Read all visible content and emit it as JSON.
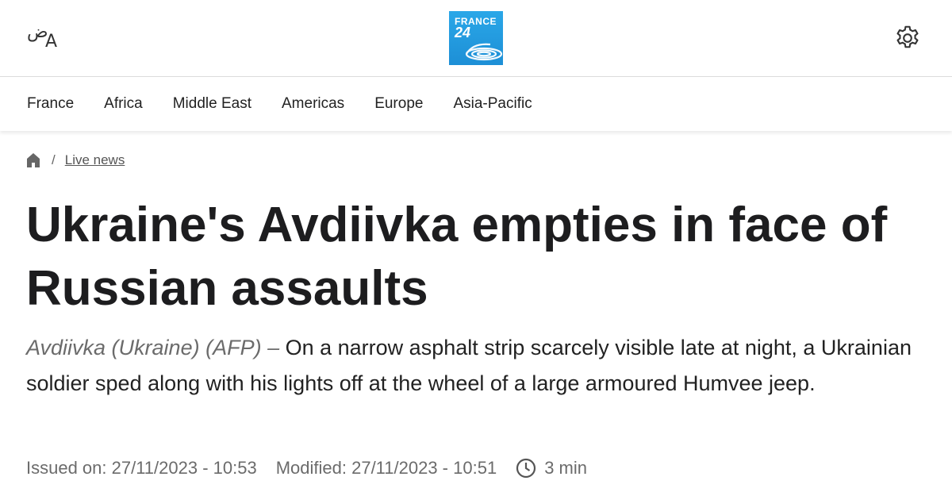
{
  "header": {
    "lang_switch": {
      "arabic_glyph": "ض",
      "latin_glyph": "A",
      "icon": "language-icon"
    },
    "logo": {
      "line1": "FRANCE",
      "line2": "24",
      "brand_color": "#1d8fd6"
    },
    "settings_icon": "gear-icon"
  },
  "nav": {
    "items": [
      {
        "label": "France"
      },
      {
        "label": "Africa"
      },
      {
        "label": "Middle East"
      },
      {
        "label": "Americas"
      },
      {
        "label": "Europe"
      },
      {
        "label": "Asia-Pacific"
      }
    ]
  },
  "breadcrumb": {
    "home_icon": "home-icon",
    "separator": "/",
    "link": "Live news"
  },
  "article": {
    "title": "Ukraine's Avdiivka empties in face of Russian assaults",
    "dateline": "Avdiivka (Ukraine) (AFP) –",
    "lead": "On a narrow asphalt strip scarcely visible late at night, a Ukrainian soldier sped along with his lights off at the wheel of a large armoured Humvee jeep.",
    "issued": "Issued on: 27/11/2023 - 10:53",
    "modified": "Modified: 27/11/2023 - 10:51",
    "reading_time": "3 min",
    "reading_icon": "clock-icon"
  }
}
